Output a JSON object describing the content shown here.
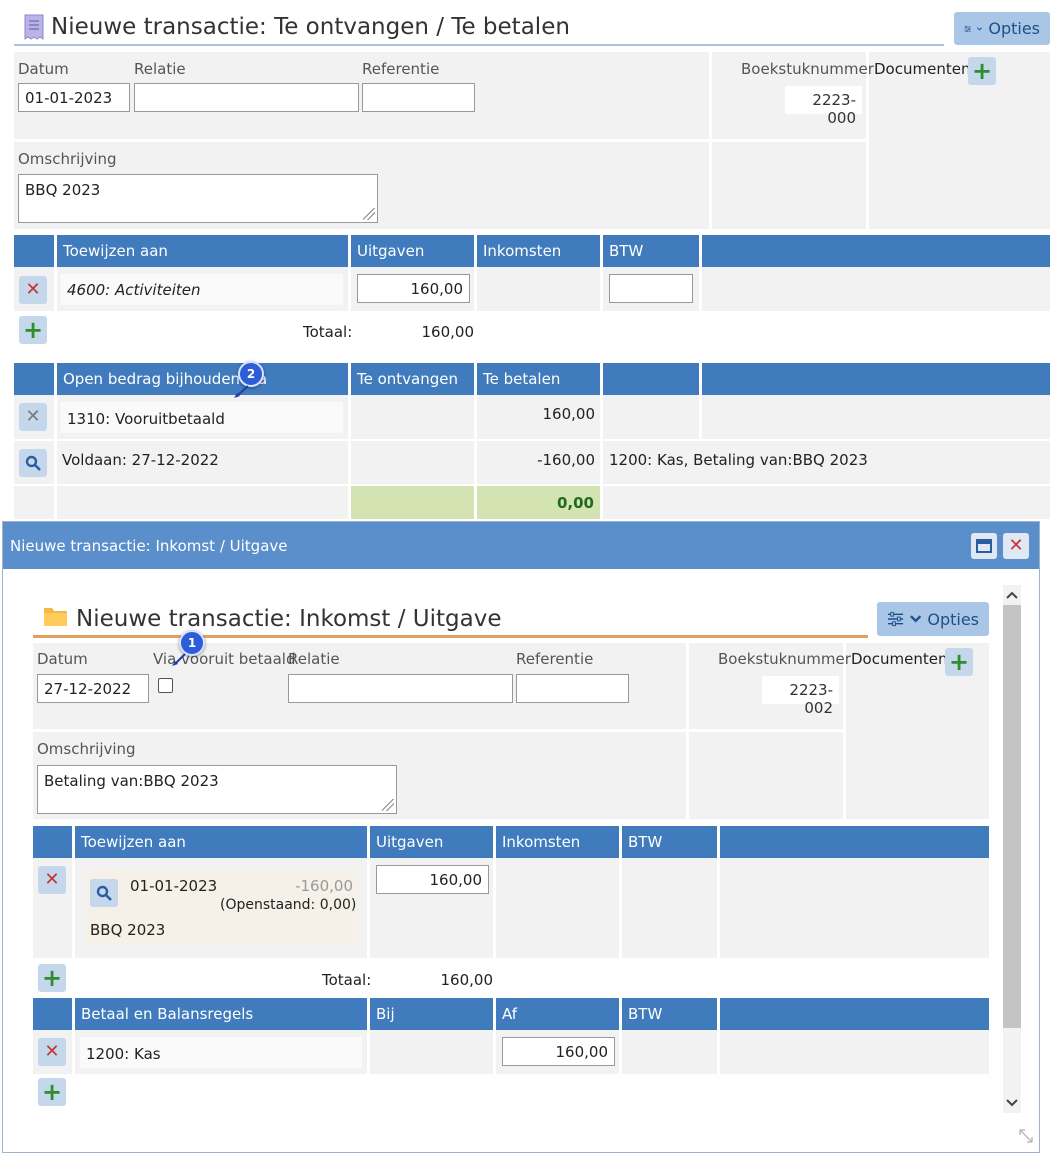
{
  "main": {
    "title": "Nieuwe transactie: Te ontvangen / Te betalen",
    "options_label": "Opties",
    "labels": {
      "datum": "Datum",
      "relatie": "Relatie",
      "referentie": "Referentie",
      "boekstuknummer": "Boekstuknummer",
      "documenten": "Documenten",
      "omschrijving": "Omschrijving"
    },
    "datum_value": "01-01-2023",
    "relatie_value": "",
    "referentie_value": "",
    "boekstuknummer_value": "2223-000",
    "omschrijving_value": "BBQ 2023",
    "alloc_headers": {
      "toewijzen": "Toewijzen aan",
      "uitgaven": "Uitgaven",
      "inkomsten": "Inkomsten",
      "btw": "BTW"
    },
    "alloc_row": {
      "account": "4600: Activiteiten",
      "uitgaven": "160,00",
      "btw": ""
    },
    "totaal_label": "Totaal:",
    "totaal_value": "160,00",
    "open_headers": {
      "open_bedrag": "Open bedrag bijhouden via",
      "te_ontvangen": "Te ontvangen",
      "te_betalen": "Te betalen"
    },
    "open_row1": {
      "account": "1310: Vooruitbetaald",
      "te_betalen": "160,00"
    },
    "open_row2": {
      "voldaan": "Voldaan: 27-12-2022",
      "te_betalen": "-160,00",
      "desc": "1200: Kas, Betaling van:BBQ 2023"
    },
    "balance_total": "0,00"
  },
  "badges": {
    "one": "1",
    "two": "2"
  },
  "dialog": {
    "window_title": "Nieuwe transactie: Inkomst / Uitgave",
    "title": "Nieuwe transactie: Inkomst / Uitgave",
    "options_label": "Opties",
    "labels": {
      "datum": "Datum",
      "via_vooruit": "Via vooruit betaald",
      "relatie": "Relatie",
      "referentie": "Referentie",
      "boekstuknummer": "Boekstuknummer",
      "documenten": "Documenten",
      "omschrijving": "Omschrijving"
    },
    "datum_value": "27-12-2022",
    "relatie_value": "",
    "referentie_value": "",
    "boekstuknummer_value": "2223-002",
    "omschrijving_value": "Betaling van:BBQ 2023",
    "alloc_headers": {
      "toewijzen": "Toewijzen aan",
      "uitgaven": "Uitgaven",
      "inkomsten": "Inkomsten",
      "btw": "BTW"
    },
    "alloc_row": {
      "date": "01-01-2023",
      "amount": "-160,00",
      "openstaand": "(Openstaand: 0,00)",
      "desc": "BBQ 2023",
      "uitgaven": "160,00"
    },
    "totaal_label": "Totaal:",
    "totaal_value": "160,00",
    "balans_headers": {
      "betaal": "Betaal en Balansregels",
      "bij": "Bij",
      "af": "Af",
      "btw": "BTW"
    },
    "balans_row": {
      "account": "1200: Kas",
      "af": "160,00"
    }
  },
  "colors": {
    "header_blue": "#3f7bbd",
    "dialog_blue": "#5a8fcb",
    "total_green": "#d3e4b2",
    "total_text": "#1f6b1f",
    "accent_orange": "#e0a060"
  },
  "icons": {
    "receipt": "receipt-icon",
    "folder": "folder-icon",
    "sliders": "sliders-icon",
    "search": "search-icon",
    "close": "close-icon",
    "plus": "plus-icon",
    "maximize": "maximize-icon",
    "resize": "resize-icon"
  }
}
